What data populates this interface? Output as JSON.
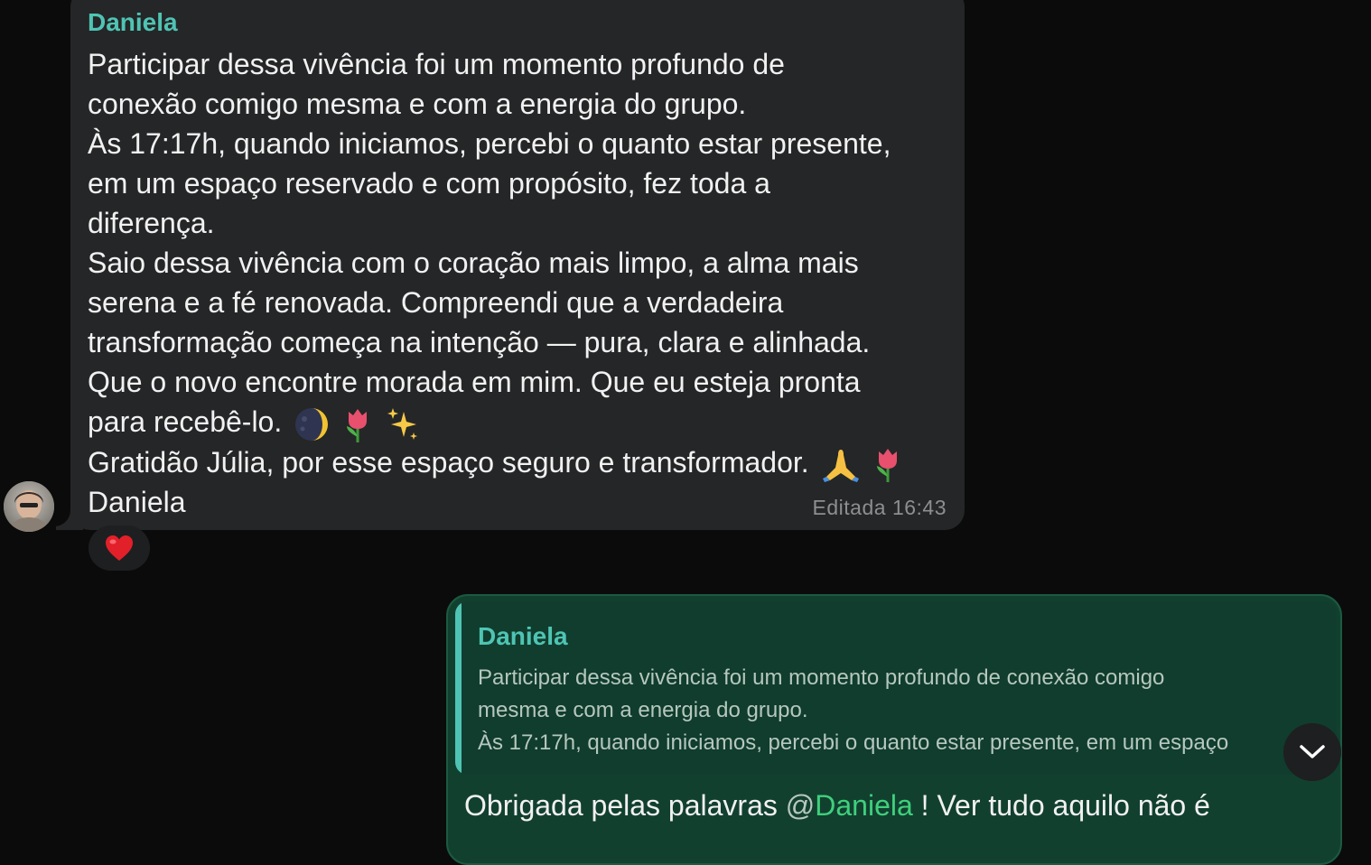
{
  "incoming": {
    "sender": "Daniela",
    "lines": [
      "Participar dessa vivência foi um momento profundo de",
      "conexão comigo mesma e com a energia do grupo.",
      "Às 17:17h, quando iniciamos, percebi o quanto estar presente,",
      "em um espaço reservado e com propósito, fez toda a",
      "diferença.",
      "Saio dessa vivência com o coração mais limpo, a alma mais",
      "serena e a fé renovada. Compreendi que a verdadeira",
      "transformação começa na intenção — pura, clara e alinhada.",
      "Que o novo encontre morada em mim. Que eu esteja pronta",
      "para recebê-lo.",
      "Gratidão Júlia, por esse espaço seguro e transformador.",
      "Daniela"
    ],
    "timestamp": "Editada 16:43",
    "reaction": "❤️"
  },
  "outgoing": {
    "quote": {
      "sender": "Daniela",
      "lines": [
        "Participar dessa vivência foi um momento profundo de conexão comigo",
        "mesma e com a energia do grupo.",
        "Às 17:17h, quando iniciamos, percebi o quanto estar presente, em um espaço"
      ]
    },
    "text_before": "Obrigada pelas palavras ",
    "mention_at": "@",
    "mention_name": "Daniela",
    "text_after": " ! Ver tudo aquilo não é"
  },
  "colors": {
    "background": "#0b0b0b",
    "incoming_bubble": "#252627",
    "outgoing_bubble": "#12402f",
    "sender_name": "#4fc4b4",
    "mention": "#3fd07c"
  }
}
